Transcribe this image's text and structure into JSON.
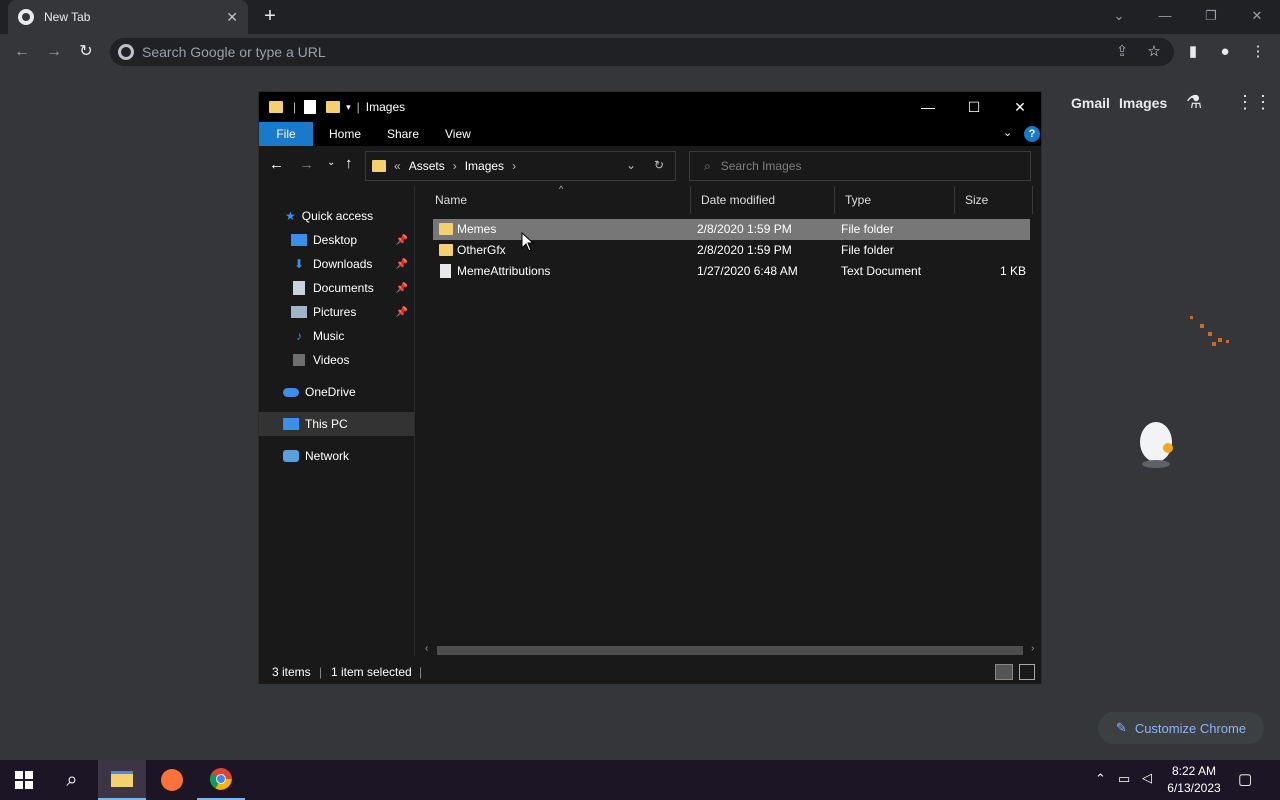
{
  "browser": {
    "tab_title": "New Tab",
    "omnibox_placeholder": "Search Google or type a URL",
    "ntp_links": {
      "gmail": "Gmail",
      "images": "Images"
    },
    "customize_label": "Customize Chrome"
  },
  "explorer": {
    "title": "Images",
    "ribbon_tabs": {
      "file": "File",
      "home": "Home",
      "share": "Share",
      "view": "View"
    },
    "breadcrumb": {
      "prefix": "«",
      "items": [
        "Assets",
        "Images"
      ]
    },
    "search_placeholder": "Search Images",
    "nav": {
      "quick_access": "Quick access",
      "desktop": "Desktop",
      "downloads": "Downloads",
      "documents": "Documents",
      "pictures": "Pictures",
      "music": "Music",
      "videos": "Videos",
      "onedrive": "OneDrive",
      "this_pc": "This PC",
      "network": "Network"
    },
    "columns": {
      "name": "Name",
      "date": "Date modified",
      "type": "Type",
      "size": "Size"
    },
    "files": [
      {
        "name": "Memes",
        "date": "2/8/2020 1:59 PM",
        "type": "File folder",
        "size": "",
        "selected": true
      },
      {
        "name": "OtherGfx",
        "date": "2/8/2020 1:59 PM",
        "type": "File folder",
        "size": "",
        "selected": false
      },
      {
        "name": "MemeAttributions",
        "date": "1/27/2020 6:48 AM",
        "type": "Text Document",
        "size": "1 KB",
        "selected": false
      }
    ],
    "status": {
      "count": "3 items",
      "selected": "1 item selected"
    }
  },
  "taskbar": {
    "time": "8:22 AM",
    "date": "6/13/2023"
  },
  "colors": {
    "selection": "#777777",
    "accent": "#1979ca",
    "folder": "#f4d06f"
  }
}
